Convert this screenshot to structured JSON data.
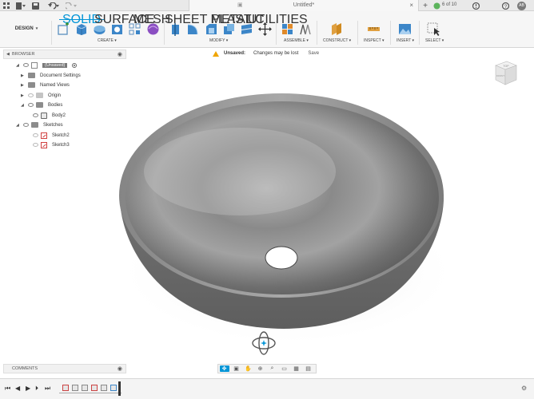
{
  "titlebar": {
    "document_title": "Untitled*",
    "jobs_label": "6 of 10",
    "avatar_initials": "AB",
    "icons": [
      "app-grid-icon",
      "file-menu-icon",
      "save-icon",
      "undo-icon",
      "redo-icon",
      "close-tab-icon",
      "new-tab-icon",
      "jobs-status-icon",
      "notification-icon",
      "help-icon"
    ]
  },
  "workspace": {
    "label": "DESIGN",
    "caret": "▾"
  },
  "tabs": [
    {
      "label": "SOLID",
      "active": true
    },
    {
      "label": "SURFACE",
      "active": false
    },
    {
      "label": "MESH",
      "active": false
    },
    {
      "label": "SHEET METAL",
      "active": false
    },
    {
      "label": "PLASTIC",
      "active": false
    },
    {
      "label": "UTILITIES",
      "active": false
    }
  ],
  "toolbar_groups": [
    {
      "label": "CREATE ▾"
    },
    {
      "label": "MODIFY ▾"
    },
    {
      "label": "ASSEMBLE ▾"
    },
    {
      "label": "CONSTRUCT ▾"
    },
    {
      "label": "INSPECT ▾"
    },
    {
      "label": "INSERT ▾"
    },
    {
      "label": "SELECT ▾"
    }
  ],
  "unsaved_bar": {
    "title": "Unsaved:",
    "message": "Changes may be lost",
    "save_label": "Save"
  },
  "browser": {
    "title": "BROWSER",
    "items": [
      {
        "label": "(Unsaved)"
      },
      {
        "label": "Document Settings"
      },
      {
        "label": "Named Views"
      },
      {
        "label": "Origin"
      },
      {
        "label": "Bodies"
      },
      {
        "label": "Body2"
      },
      {
        "label": "Sketches"
      },
      {
        "label": "Sketch2"
      },
      {
        "label": "Sketch3"
      }
    ]
  },
  "viewcube": {
    "face_label": "TOP",
    "side_label": "FRONT"
  },
  "comments": {
    "title": "COMMENTS"
  },
  "colors": {
    "accent": "#0696d7",
    "model_gray": "#6e6e6e",
    "warning": "#f0a500",
    "sketch_red": "#d04040"
  }
}
